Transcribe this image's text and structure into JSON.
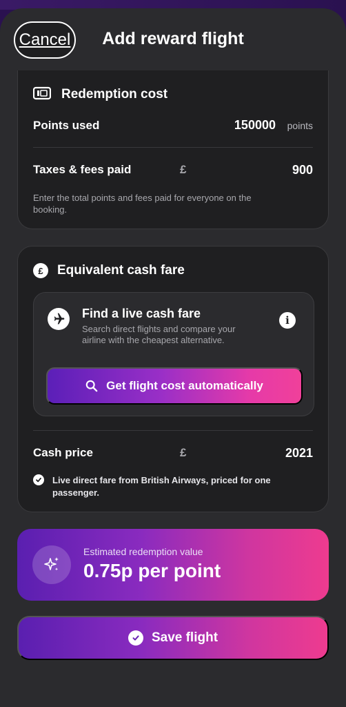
{
  "header": {
    "cancel_label": "Cancel",
    "title": "Add reward flight"
  },
  "redemption": {
    "title": "Redemption cost",
    "icon": "ticket-icon",
    "points_label": "Points used",
    "points_value": "150000",
    "points_unit": "points",
    "taxes_label": "Taxes & fees paid",
    "taxes_currency": "£",
    "taxes_value": "900",
    "helper": "Enter the total points and fees paid for everyone on the booking."
  },
  "cash_fare": {
    "title": "Equivalent cash fare",
    "icon": "pound-coin-icon",
    "finder": {
      "title": "Find a live cash fare",
      "description": "Search direct flights and compare your airline with the cheapest alternative.",
      "button_label": "Get flight cost automatically"
    },
    "cash_label": "Cash price",
    "cash_currency": "£",
    "cash_value": "2021",
    "note": "Live direct fare from British Airways, priced for one passenger."
  },
  "estimate": {
    "label": "Estimated redemption value",
    "value": "0.75p per point"
  },
  "save": {
    "label": "Save flight"
  },
  "colors": {
    "background": "#2b2b2e",
    "card": "#1f1f21",
    "gradient_start": "#5a1fb0",
    "gradient_end": "#ee3b8f"
  }
}
